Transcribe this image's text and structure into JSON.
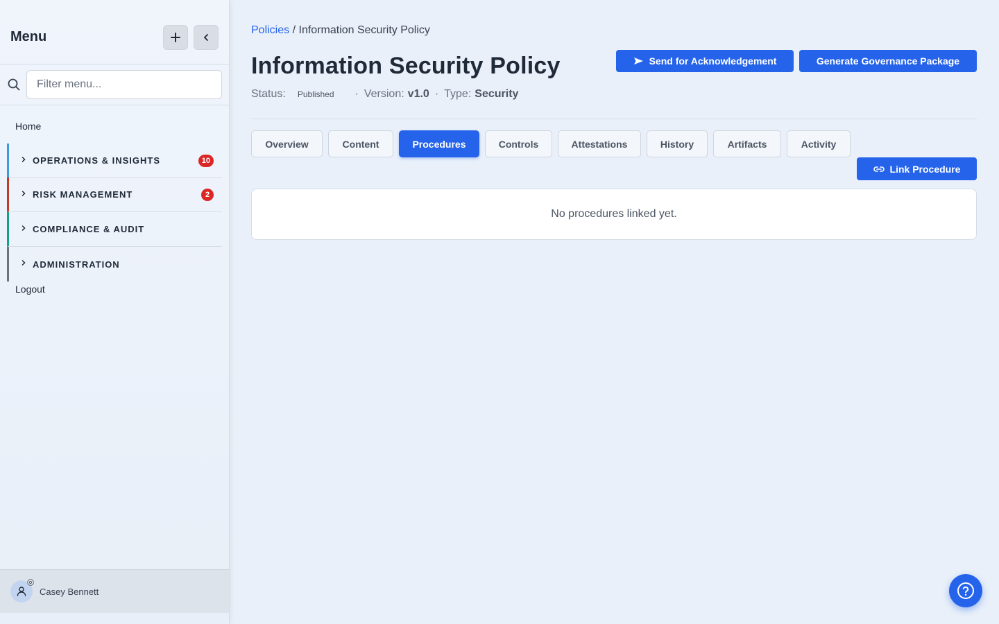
{
  "sidebar": {
    "title": "Menu",
    "filter_placeholder": "Filter menu...",
    "home": "Home",
    "groups": [
      {
        "label": "OPERATIONS & INSIGHTS",
        "badge": "10",
        "accent": "#3b9ad9"
      },
      {
        "label": "RISK MANAGEMENT",
        "badge": "2",
        "accent": "#c0392b"
      },
      {
        "label": "COMPLIANCE & AUDIT",
        "badge": "",
        "accent": "#16a085"
      },
      {
        "label": "ADMINISTRATION",
        "badge": "",
        "accent": "#6b7280"
      }
    ],
    "logout": "Logout",
    "user": {
      "name": "Casey Bennett"
    }
  },
  "breadcrumb": {
    "parent": "Policies",
    "separator": "/",
    "current": "Information Security Policy"
  },
  "page": {
    "title": "Information Security Policy",
    "status_label": "Status:",
    "status_value": "Published",
    "version_label": "Version:",
    "version_value": "v1.0",
    "type_label": "Type:",
    "type_value": "Security"
  },
  "actions": {
    "send_ack": "Send for Acknowledgement",
    "gen_gov": "Generate Governance Package",
    "link_procedure": "Link Procedure"
  },
  "tabs": [
    {
      "label": "Overview"
    },
    {
      "label": "Content"
    },
    {
      "label": "Procedures",
      "active": true
    },
    {
      "label": "Controls"
    },
    {
      "label": "Attestations"
    },
    {
      "label": "History"
    },
    {
      "label": "Artifacts"
    },
    {
      "label": "Activity"
    }
  ],
  "procedures": {
    "empty_text": "No procedures linked yet."
  },
  "colors": {
    "primary": "#2563eb",
    "badge": "#dc2626"
  }
}
